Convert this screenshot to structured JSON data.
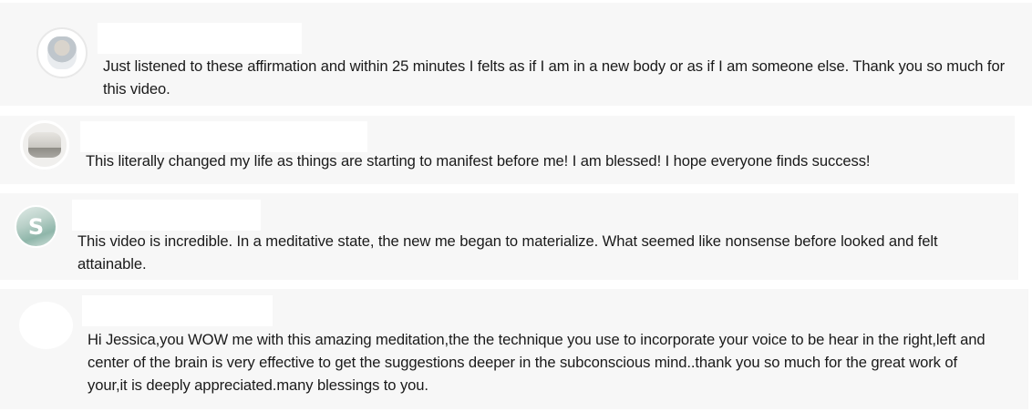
{
  "comments": [
    {
      "avatar": "user-photo-avatar",
      "text": "Just listened to these affirmation and within 25 minutes I felts as if I am in a new body or as if I am someone else. Thank you so much for this video."
    },
    {
      "avatar": "user-photo-avatar",
      "text": "This literally changed my life as things are starting to manifest before me! I am blessed! I hope everyone finds success!"
    },
    {
      "avatar": "letter-avatar",
      "avatar_letter": "S",
      "text": "This video is incredible.  In a meditative state, the new me began to materialize.  What seemed like nonsense before looked and felt attainable."
    },
    {
      "avatar": "blank-avatar",
      "text": "Hi Jessica,you WOW me with this amazing meditation,the the technique you use to incorporate your voice to be hear in the right,left and center of the brain is very effective to get the suggestions deeper in the subconscious mind..thank you so much for the great work of your,it is deeply appreciated.many blessings to you."
    }
  ],
  "colors": {
    "card_background": "#f7f7f7",
    "text": "#1a1a1a",
    "redaction": "#ffffff"
  }
}
